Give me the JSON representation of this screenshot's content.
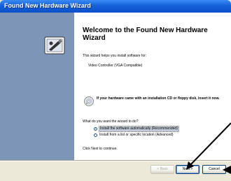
{
  "window": {
    "title": "Found New Hardware Wizard"
  },
  "wizard": {
    "heading": "Welcome to the Found New Hardware Wizard",
    "intro": "This wizard helps you install software for:",
    "device": "Video Controller (VGA Compatible)",
    "cd_prompt": "If your hardware came with an installation CD or floppy disk, insert it now.",
    "question": "What do you want the wizard to do?",
    "options": [
      {
        "label": "Install the software automatically (Recommended)",
        "selected": true
      },
      {
        "label": "Install from a list or specific location (Advanced)",
        "selected": false
      }
    ],
    "continue_text": "Click Next to continue."
  },
  "buttons": {
    "back": "< Back",
    "next": "Next >",
    "cancel": "Cancel"
  },
  "colors": {
    "titlebar": "#0b4fc9",
    "left_panel": "#7d95b7",
    "dialog_bg": "#ece9d8",
    "arrow": "#000000"
  },
  "icons": {
    "wizard": "hardware-wizard-icon",
    "cd": "cd-icon"
  }
}
